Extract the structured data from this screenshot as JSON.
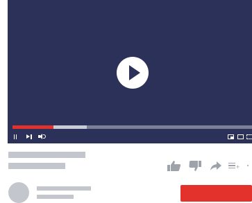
{
  "player": {
    "state": "paused",
    "background_color": "#2b3158",
    "played_fraction": 0.17,
    "buffered_fraction": 0.31,
    "progress_color": "#e2322b"
  },
  "controls": {
    "left_icons": [
      "pause-icon",
      "next-icon",
      "volume-icon"
    ],
    "right_icons": [
      "miniplayer-icon",
      "theater-icon",
      "fullscreen-icon"
    ]
  },
  "actions": [
    "like-icon",
    "dislike-icon",
    "share-icon",
    "add-to-playlist-icon",
    "more-icon"
  ],
  "colors": {
    "placeholder": "#c3c6cc",
    "icon": "#9ea2aa",
    "subscribe": "#e2322b"
  }
}
